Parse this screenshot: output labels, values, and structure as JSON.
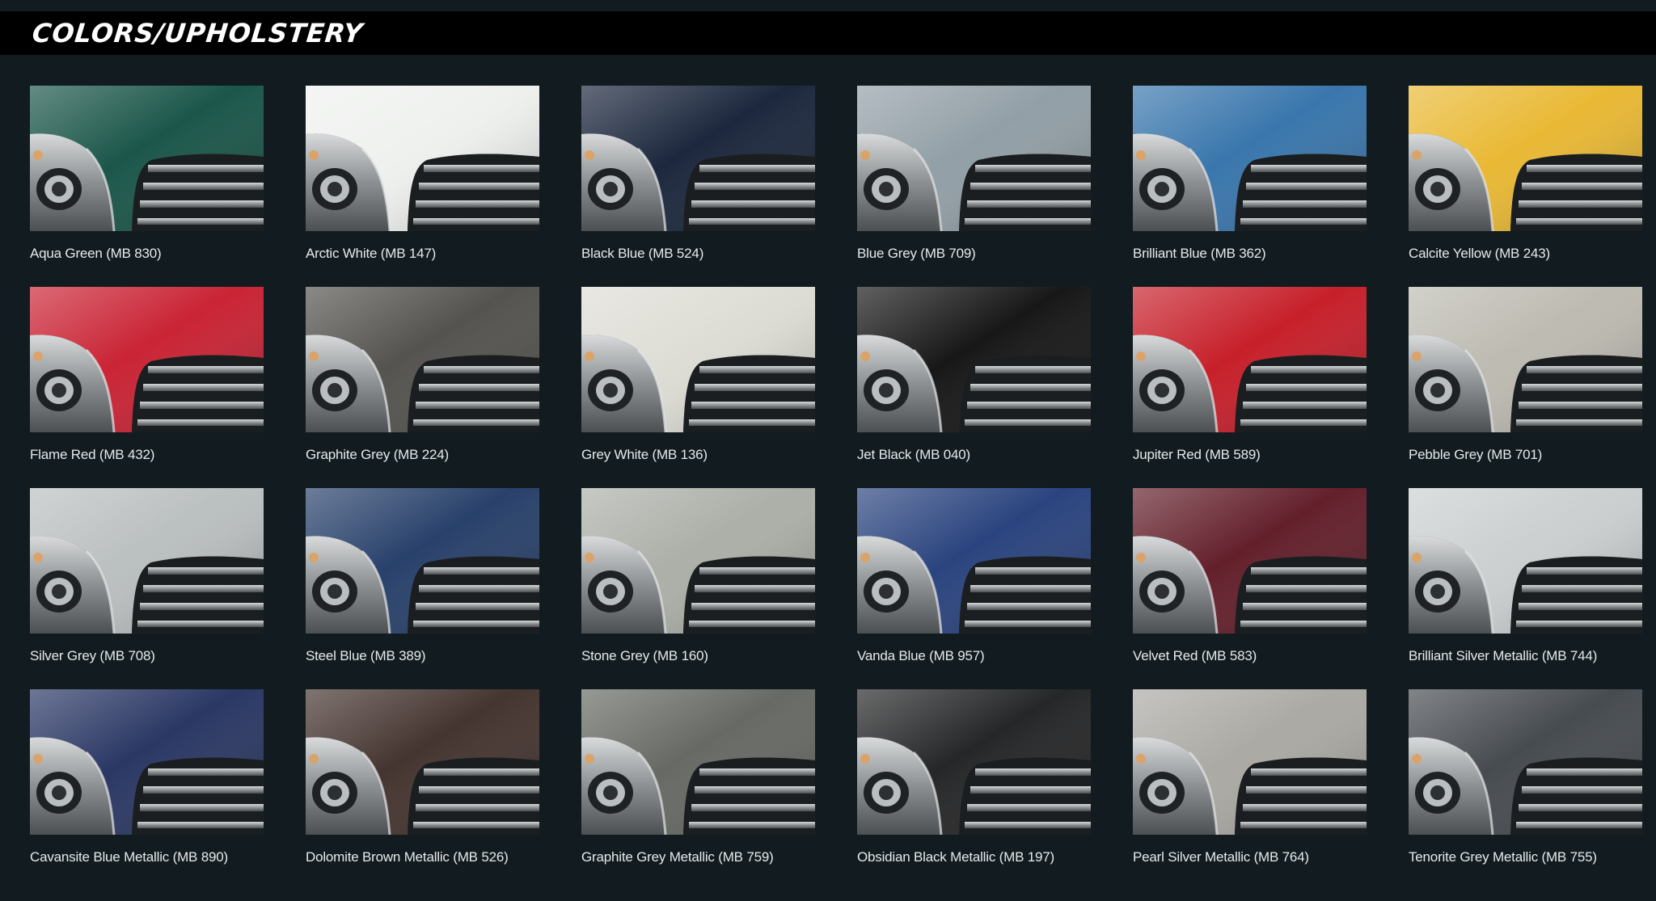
{
  "header": {
    "title": "COLORS/UPHOLSTERY"
  },
  "swatches": [
    {
      "label": "Aqua Green (MB 830)",
      "color": "#0f4d40"
    },
    {
      "label": "Arctic White (MB 147)",
      "color": "#eef0ee"
    },
    {
      "label": "Black Blue (MB 524)",
      "color": "#101c33"
    },
    {
      "label": "Blue Grey (MB 709)",
      "color": "#8d9aa2"
    },
    {
      "label": "Brilliant Blue (MB 362)",
      "color": "#2f6fa8"
    },
    {
      "label": "Calcite Yellow (MB 243)",
      "color": "#e8b52a"
    },
    {
      "label": "Flame Red (MB 432)",
      "color": "#c7182a"
    },
    {
      "label": "Graphite Grey (MB 224)",
      "color": "#4b4a46"
    },
    {
      "label": "Grey White (MB 136)",
      "color": "#dcdbd3"
    },
    {
      "label": "Jet Black (MB 040)",
      "color": "#0b0b0b"
    },
    {
      "label": "Jupiter Red (MB 589)",
      "color": "#c4141f"
    },
    {
      "label": "Pebble Grey (MB 701)",
      "color": "#b9b7ad"
    },
    {
      "label": "Silver Grey (MB 708)",
      "color": "#b7bcbc"
    },
    {
      "label": "Steel Blue (MB 389)",
      "color": "#1d3763"
    },
    {
      "label": "Stone Grey (MB 160)",
      "color": "#a8aca4"
    },
    {
      "label": "Vanda Blue (MB 957)",
      "color": "#1f3a78"
    },
    {
      "label": "Velvet Red (MB 583)",
      "color": "#5b1420"
    },
    {
      "label": "Brilliant Silver Metallic (MB 744)",
      "color": "#c9cdce"
    },
    {
      "label": "Cavansite Blue Metallic (MB 890)",
      "color": "#1f2d5c"
    },
    {
      "label": "Dolomite Brown Metallic (MB 526)",
      "color": "#3b2a25"
    },
    {
      "label": "Graphite Grey Metallic (MB 759)",
      "color": "#5f625c"
    },
    {
      "label": "Obsidian Black Metallic (MB 197)",
      "color": "#1a1b1c"
    },
    {
      "label": "Pearl Silver Metallic (MB 764)",
      "color": "#a7a59f"
    },
    {
      "label": "Tenorite Grey Metallic (MB 755)",
      "color": "#3d4247"
    }
  ]
}
